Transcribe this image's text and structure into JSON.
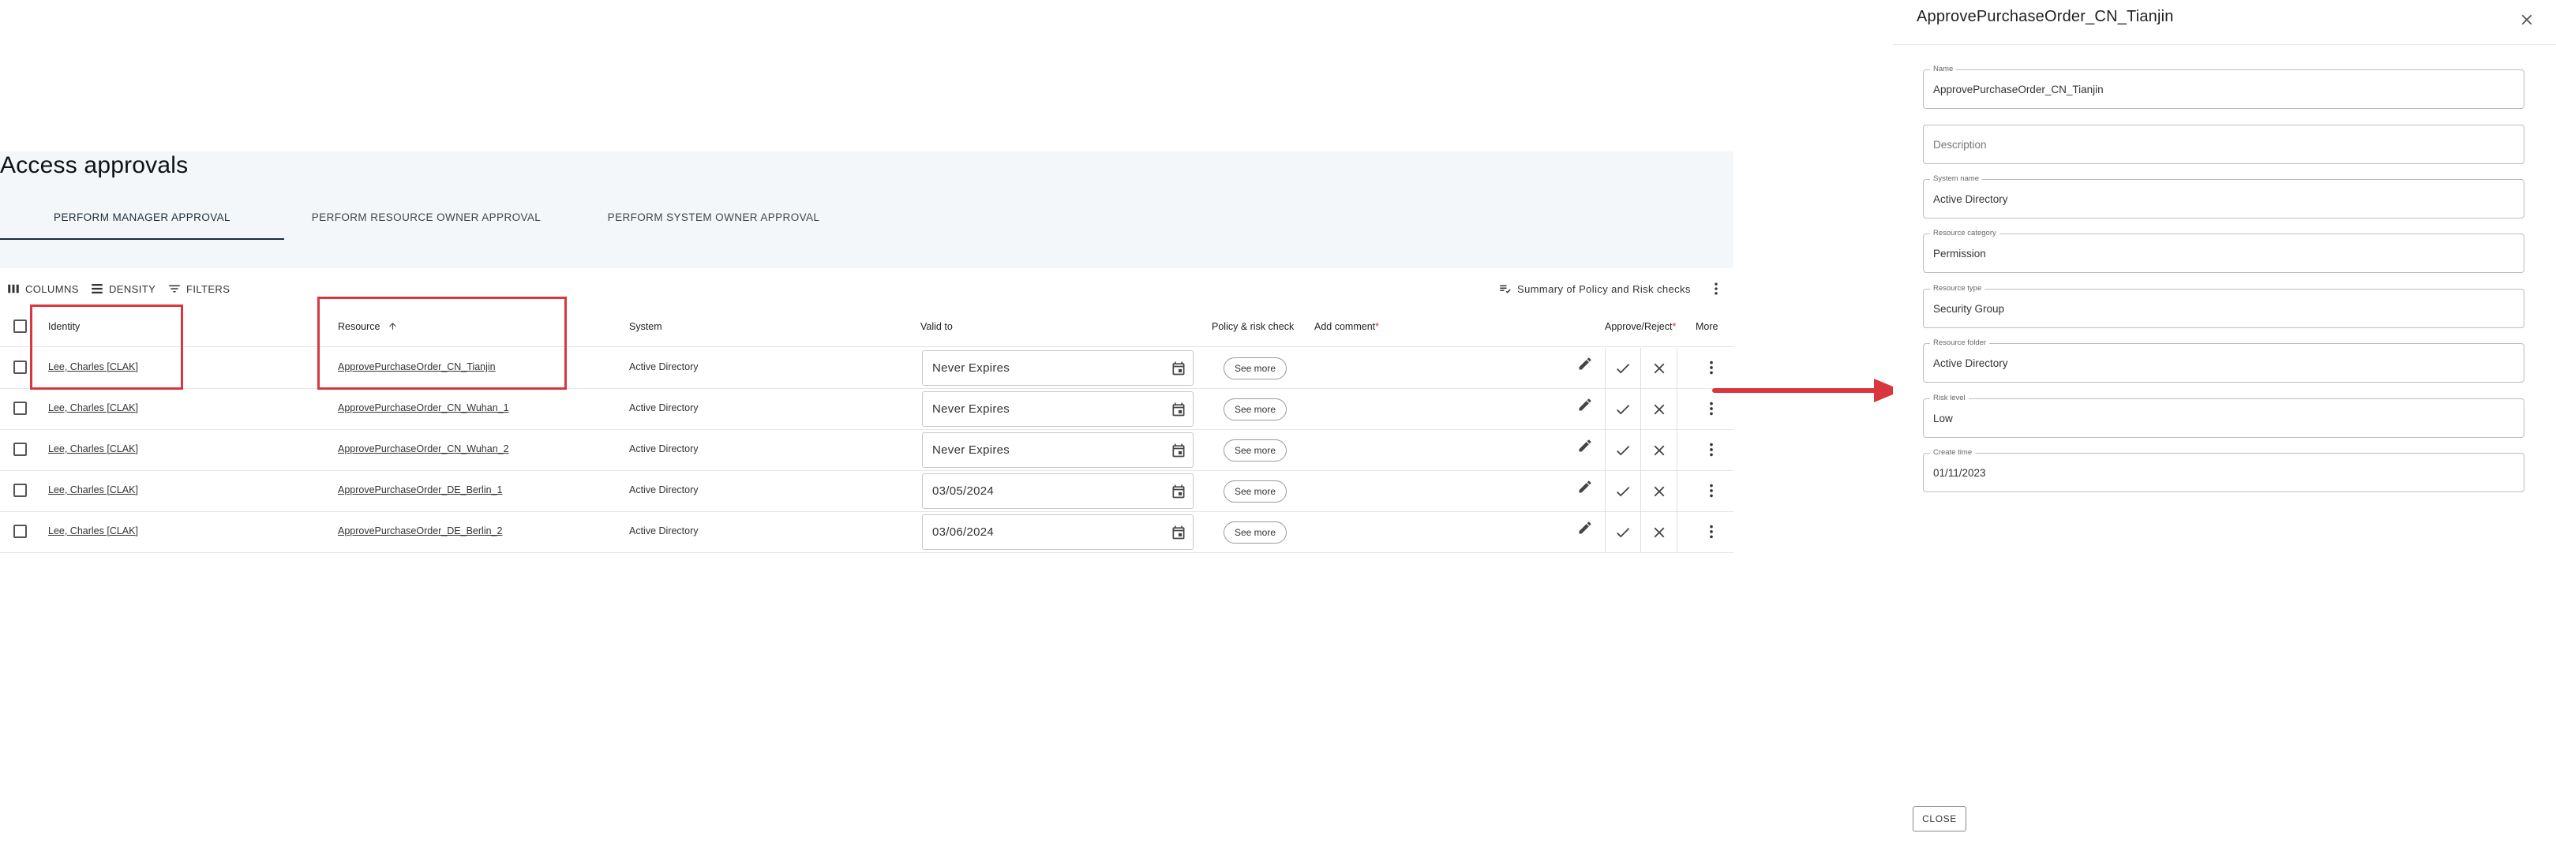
{
  "page": {
    "title": "Access approvals",
    "tabs": [
      {
        "label": "PERFORM MANAGER APPROVAL",
        "active": true
      },
      {
        "label": "PERFORM RESOURCE OWNER APPROVAL",
        "active": false
      },
      {
        "label": "PERFORM SYSTEM OWNER APPROVAL",
        "active": false
      }
    ]
  },
  "toolbar": {
    "columns": "COLUMNS",
    "density": "DENSITY",
    "filters": "FILTERS",
    "summary": "Summary of Policy and Risk checks"
  },
  "table": {
    "headers": {
      "identity": "Identity",
      "resource": "Resource",
      "system": "System",
      "valid_to": "Valid to",
      "policy": "Policy & risk check",
      "comment": "Add comment",
      "comment_required": "*",
      "approve": "Approve/Reject",
      "approve_required": "*",
      "more": "More"
    },
    "sort": {
      "column": "Resource",
      "direction": "ascending",
      "icon": "arrow-up-icon"
    },
    "see_more_label": "See more",
    "rows": [
      {
        "identity": "Lee, Charles [CLAK]",
        "resource": "ApprovePurchaseOrder_CN_Tianjin",
        "system": "Active Directory",
        "valid_to": "Never Expires"
      },
      {
        "identity": "Lee, Charles [CLAK]",
        "resource": "ApprovePurchaseOrder_CN_Wuhan_1",
        "system": "Active Directory",
        "valid_to": "Never Expires"
      },
      {
        "identity": "Lee, Charles [CLAK]",
        "resource": "ApprovePurchaseOrder_CN_Wuhan_2",
        "system": "Active Directory",
        "valid_to": "Never Expires"
      },
      {
        "identity": "Lee, Charles [CLAK]",
        "resource": "ApprovePurchaseOrder_DE_Berlin_1",
        "system": "Active Directory",
        "valid_to": "03/05/2024"
      },
      {
        "identity": "Lee, Charles [CLAK]",
        "resource": "ApprovePurchaseOrder_DE_Berlin_2",
        "system": "Active Directory",
        "valid_to": "03/06/2024"
      }
    ]
  },
  "annotation": {
    "highlight_color": "#d9363e",
    "arrow_color": "#d9363e"
  },
  "drawer": {
    "title": "ApprovePurchaseOrder_CN_Tianjin",
    "close_label": "CLOSE",
    "fields": [
      {
        "label": "Name",
        "value": "ApprovePurchaseOrder_CN_Tianjin"
      },
      {
        "label": "",
        "value": "",
        "placeholder": "Description"
      },
      {
        "label": "System name",
        "value": "Active Directory"
      },
      {
        "label": "Resource category",
        "value": "Permission"
      },
      {
        "label": "Resource type",
        "value": "Security Group"
      },
      {
        "label": "Resource folder",
        "value": "Active Directory"
      },
      {
        "label": "Risk level",
        "value": "Low"
      },
      {
        "label": "Create time",
        "value": "01/11/2023"
      }
    ]
  }
}
